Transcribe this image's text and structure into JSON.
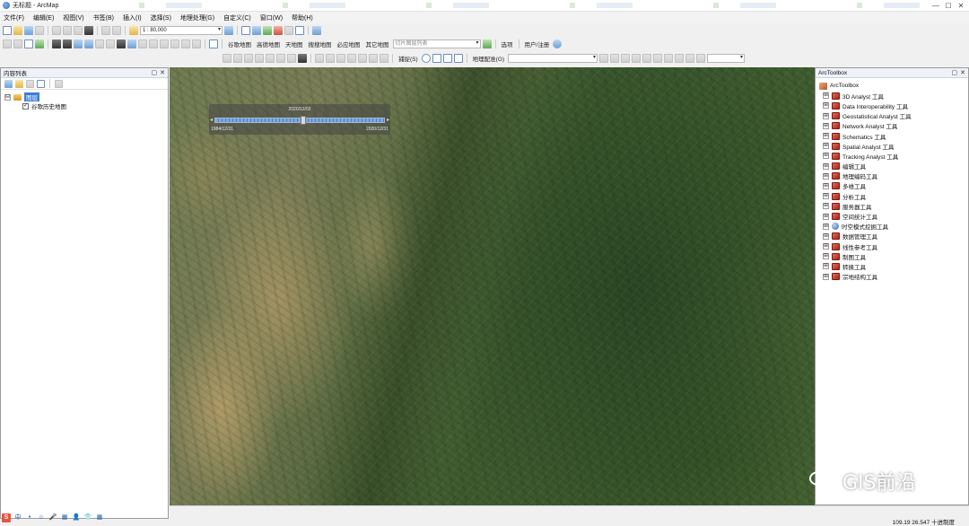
{
  "window": {
    "title": "无标题 - ArcMap",
    "min_glyph": "—",
    "max_glyph": "☐",
    "close_glyph": "✕"
  },
  "menu": [
    "文件(F)",
    "编辑(E)",
    "视图(V)",
    "书签(B)",
    "插入(I)",
    "选择(S)",
    "地理处理(G)",
    "自定义(C)",
    "窗口(W)",
    "帮助(H)"
  ],
  "toolbar": {
    "scale": "1 : 80,000",
    "basemaps": [
      "谷歌地图",
      "高德地图",
      "天地图",
      "搜搜地图",
      "必应地图",
      "其它地图"
    ],
    "tile_list_placeholder": "切片图层列表",
    "option_label": "选项",
    "user_label": "用户/注册",
    "snapping_label": "捕捉(S)",
    "georef_label": "地理配准(G)"
  },
  "toc": {
    "title": "内容列表",
    "layers_group": "图层",
    "layer_name": "谷歌历史地图",
    "expander": "⊟",
    "check": "✓"
  },
  "time_slider": {
    "current": "2020/12/02",
    "start": "1984/12/31",
    "end": "2020/12/31",
    "prev": "◂",
    "next": "▸",
    "position": 0.52
  },
  "toolbox": {
    "title": "ArcToolbox",
    "root": "ArcToolbox",
    "items": [
      "3D Analyst 工具",
      "Data Interoperability 工具",
      "Geostatistical Analyst 工具",
      "Network Analyst 工具",
      "Schematics 工具",
      "Spatial Analyst 工具",
      "Tracking Analyst 工具",
      "编辑工具",
      "地理编码工具",
      "多维工具",
      "分析工具",
      "服务器工具",
      "空间统计工具",
      "时空模式挖掘工具",
      "数据管理工具",
      "线性参考工具",
      "制图工具",
      "转换工具",
      "宗地结构工具"
    ],
    "expander": "⊞"
  },
  "status": {
    "coords": "109.19   26.547 十进制度"
  },
  "watermark": "GIS前沿",
  "taskbar": [
    "S",
    "中",
    "•",
    "☺",
    "🎤",
    "▦",
    "👤",
    "👕",
    "▦"
  ]
}
